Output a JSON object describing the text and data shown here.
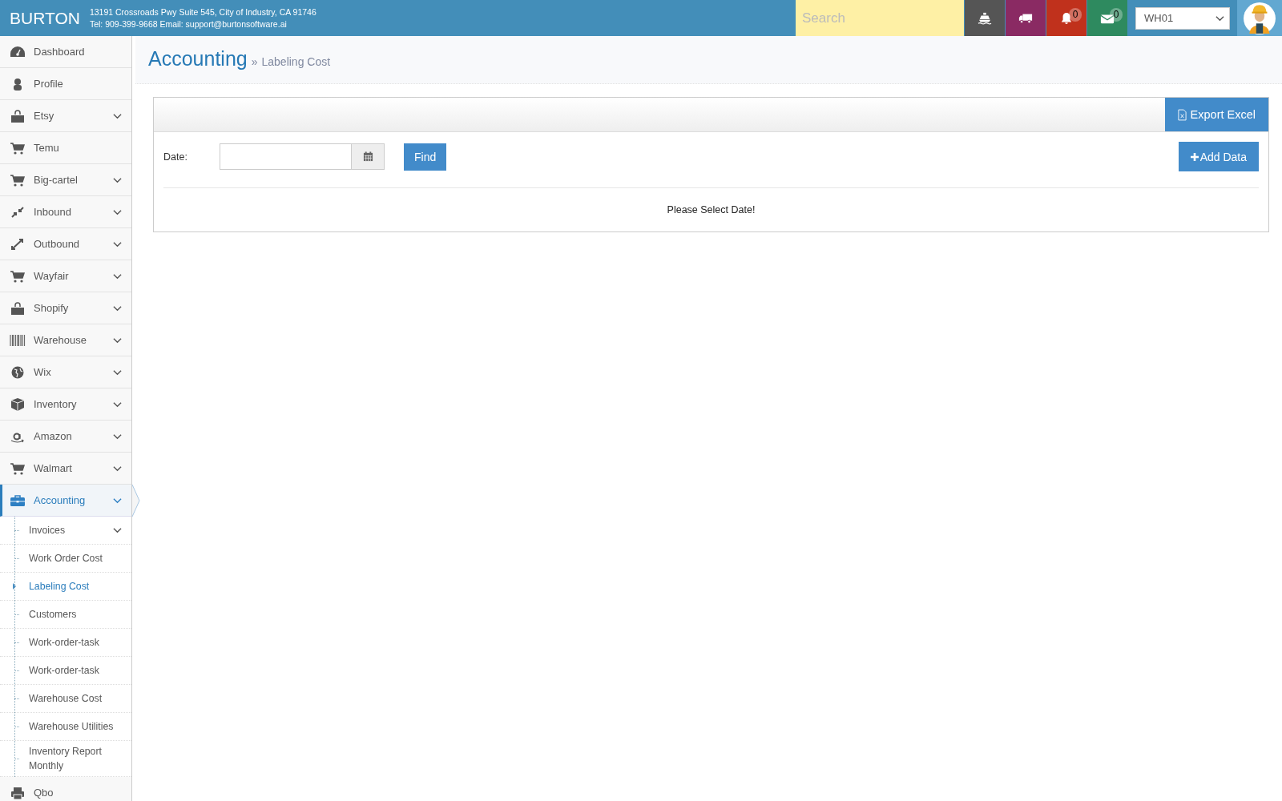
{
  "header": {
    "brand": "BURTON",
    "address": "13191 Crossroads Pwy Suite 545, City of Industry, CA 91746",
    "contact": "Tel: 909-399-9668 Email: support@burtonsoftware.ai",
    "search": {
      "placeholder": "Search"
    },
    "buttons": [
      {
        "kind": "ship",
        "color": "#555555"
      },
      {
        "kind": "truck",
        "color": "#8a2a63"
      },
      {
        "kind": "bell",
        "color": "#c0311c",
        "badge": "0"
      },
      {
        "kind": "mail",
        "color": "#2e8a5f",
        "badge": "0"
      }
    ],
    "warehouse": "WH01"
  },
  "sidebar": {
    "items": [
      {
        "label": "Dashboard",
        "kind": "dashboard",
        "expandable": false,
        "selected": false
      },
      {
        "label": "Profile",
        "kind": "user",
        "expandable": false,
        "selected": false
      },
      {
        "label": "Etsy",
        "kind": "bag",
        "expandable": true,
        "selected": false
      },
      {
        "label": "Temu",
        "kind": "cart",
        "expandable": false,
        "selected": false
      },
      {
        "label": "Big-cartel",
        "kind": "cart",
        "expandable": true,
        "selected": false
      },
      {
        "label": "Inbound",
        "kind": "compress",
        "expandable": true,
        "selected": false
      },
      {
        "label": "Outbound",
        "kind": "expand",
        "expandable": true,
        "selected": false
      },
      {
        "label": "Wayfair",
        "kind": "cart",
        "expandable": true,
        "selected": false
      },
      {
        "label": "Shopify",
        "kind": "bag",
        "expandable": true,
        "selected": false
      },
      {
        "label": "Warehouse",
        "kind": "barcode",
        "expandable": true,
        "selected": false
      },
      {
        "label": "Wix",
        "kind": "globe",
        "expandable": true,
        "selected": false
      },
      {
        "label": "Inventory",
        "kind": "cube",
        "expandable": true,
        "selected": false
      },
      {
        "label": "Amazon",
        "kind": "smile",
        "expandable": true,
        "selected": false
      },
      {
        "label": "Walmart",
        "kind": "cart",
        "expandable": true,
        "selected": false
      },
      {
        "label": "Accounting",
        "kind": "briefcase",
        "expandable": true,
        "selected": true,
        "children": [
          {
            "label": "Invoices",
            "expandable": true,
            "selected": false
          },
          {
            "label": "Work Order Cost",
            "expandable": false,
            "selected": false
          },
          {
            "label": "Labeling Cost",
            "expandable": false,
            "selected": true
          },
          {
            "label": "Customers",
            "expandable": false,
            "selected": false
          },
          {
            "label": "Work-order-task",
            "expandable": false,
            "selected": false
          },
          {
            "label": "Work-order-task",
            "expandable": false,
            "selected": false
          },
          {
            "label": "Warehouse Cost",
            "expandable": false,
            "selected": false
          },
          {
            "label": "Warehouse Utilities",
            "expandable": false,
            "selected": false
          },
          {
            "label": "Inventory Report Monthly",
            "expandable": false,
            "selected": false
          }
        ]
      },
      {
        "label": "Qbo",
        "kind": "print",
        "expandable": false,
        "selected": false
      }
    ]
  },
  "page": {
    "title": "Accounting",
    "separator": "»",
    "subtitle": "Labeling Cost"
  },
  "panel": {
    "export_button": "Export Excel",
    "date_label": "Date:",
    "find_button": "Find",
    "add_button": "Add Data",
    "message": "Please Select Date!"
  }
}
